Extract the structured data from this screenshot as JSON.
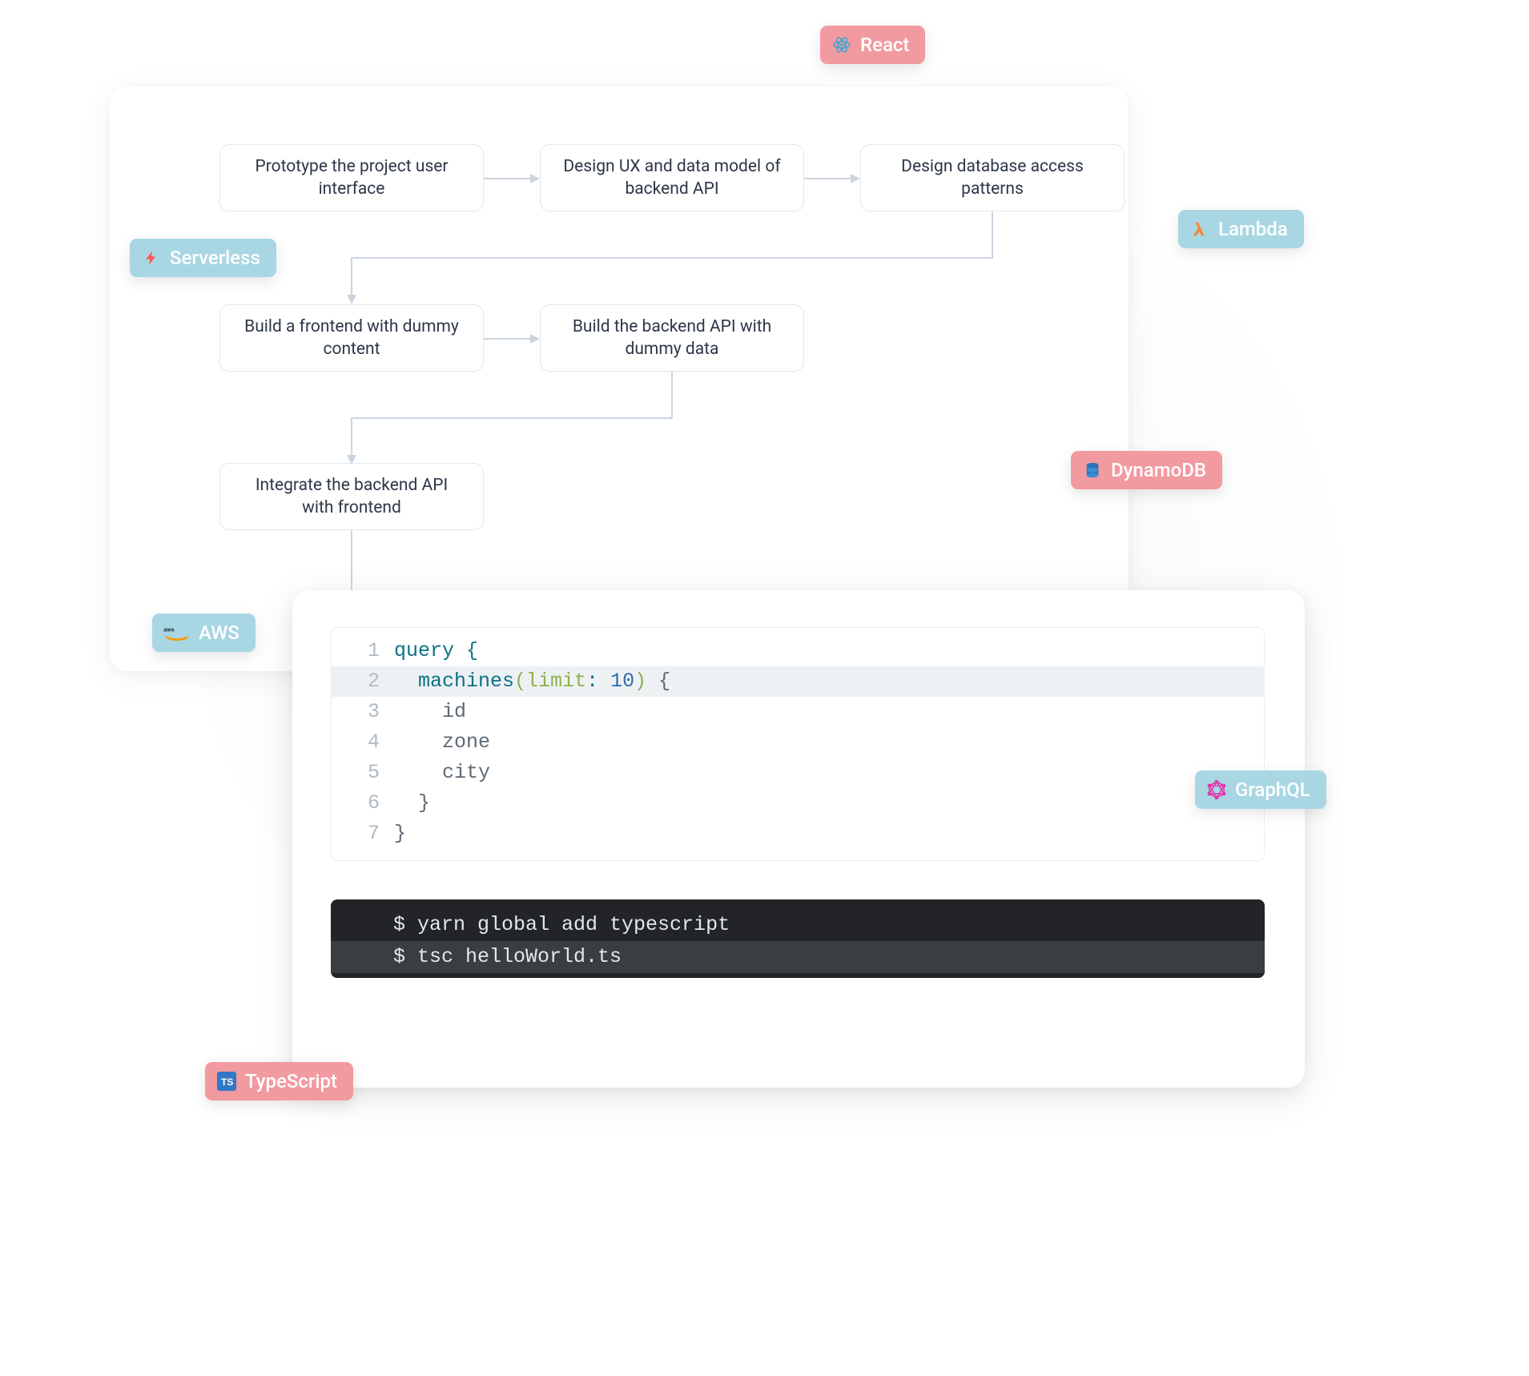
{
  "flow": {
    "n1": "Prototype the project user interface",
    "n2": "Design UX and data model of backend API",
    "n3": "Design database access patterns",
    "n4": "Build a frontend with dummy content",
    "n5": "Build the backend API with dummy data",
    "n6": "Integrate the backend API with frontend"
  },
  "editor": {
    "l1": "query {",
    "l2_a": "  machines",
    "l2_b": "(",
    "l2_c": "limit",
    "l2_d": ": ",
    "l2_e": "10",
    "l2_f": ")",
    "l2_g": " {",
    "l3": "    id",
    "l4": "    zone",
    "l5": "    city",
    "l6": "  }",
    "l7": "}",
    "gutter": {
      "1": "1",
      "2": "2",
      "3": "3",
      "4": "4",
      "5": "5",
      "6": "6",
      "7": "7"
    }
  },
  "terminal": {
    "l1": "$ yarn global add typescript",
    "l2": "$ tsc helloWorld.ts"
  },
  "tags": {
    "react": "React",
    "serverless": "Serverless",
    "lambda": "Lambda",
    "dynamodb": "DynamoDB",
    "aws": "AWS",
    "graphql": "GraphQL",
    "typescript": "TypeScript"
  },
  "colors": {
    "pink": "#f19aa0",
    "blue": "#a8d6e3",
    "nodeBorder": "#e2e8f0",
    "arrow": "#cbd5e0",
    "terminalBg": "#222427",
    "editorHighlight": "#eef1f4",
    "editorHighlightBorder": "#e53e3e"
  }
}
